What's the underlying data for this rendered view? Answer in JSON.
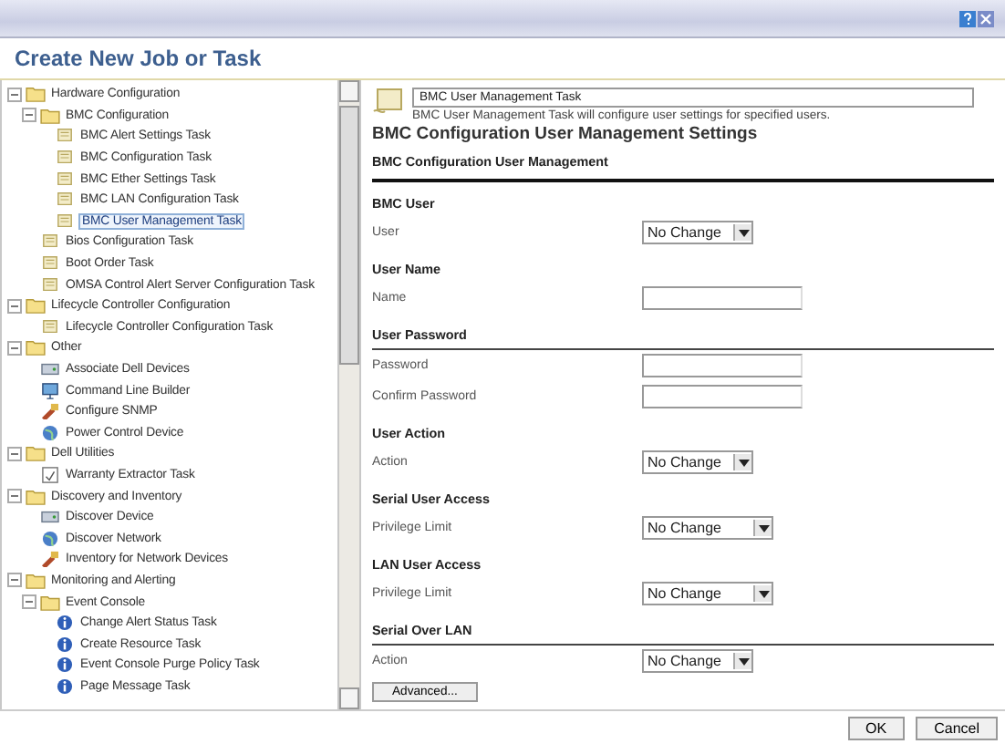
{
  "window": {
    "title": "Create New Job or Task"
  },
  "tree": [
    {
      "label": "Hardware Configuration",
      "kind": "folder",
      "expanded": true,
      "selected": false,
      "children": [
        {
          "label": "BMC Configuration",
          "kind": "folder",
          "expanded": true,
          "selected": false,
          "children": [
            {
              "label": "BMC Alert Settings Task",
              "kind": "task",
              "selected": false
            },
            {
              "label": "BMC Configuration Task",
              "kind": "task",
              "selected": false
            },
            {
              "label": "BMC Ether Settings Task",
              "kind": "task",
              "selected": false
            },
            {
              "label": "BMC LAN Configuration Task",
              "kind": "task",
              "selected": false
            },
            {
              "label": "BMC User Management Task",
              "kind": "task",
              "selected": true
            }
          ]
        },
        {
          "label": "Bios Configuration Task",
          "kind": "task",
          "selected": false
        },
        {
          "label": "Boot Order Task",
          "kind": "task",
          "selected": false
        },
        {
          "label": "OMSA Control Alert Server Configuration Task",
          "kind": "task",
          "selected": false
        }
      ]
    },
    {
      "label": "Lifecycle Controller Configuration",
      "kind": "folder",
      "expanded": true,
      "selected": false,
      "children": [
        {
          "label": "Lifecycle Controller Configuration Task",
          "kind": "task",
          "selected": false
        }
      ]
    },
    {
      "label": "Other",
      "kind": "folder",
      "expanded": true,
      "selected": false,
      "children": [
        {
          "label": "Associate Dell Devices",
          "kind": "device",
          "selected": false
        },
        {
          "label": "Command Line Builder",
          "kind": "computer",
          "selected": false
        },
        {
          "label": "Configure SNMP",
          "kind": "tool",
          "selected": false
        },
        {
          "label": "Power Control Device",
          "kind": "globe",
          "selected": false
        }
      ]
    },
    {
      "label": "Dell Utilities",
      "kind": "folder",
      "expanded": true,
      "selected": false,
      "children": [
        {
          "label": "Warranty Extractor Task",
          "kind": "document",
          "selected": false
        }
      ]
    },
    {
      "label": "Discovery and Inventory",
      "kind": "folder",
      "expanded": true,
      "selected": false,
      "children": [
        {
          "label": "Discover Device",
          "kind": "device",
          "selected": false
        },
        {
          "label": "Discover Network",
          "kind": "globe",
          "selected": false
        },
        {
          "label": "Inventory for Network Devices",
          "kind": "tool",
          "selected": false
        }
      ]
    },
    {
      "label": "Monitoring and Alerting",
      "kind": "folder",
      "expanded": true,
      "selected": false,
      "children": [
        {
          "label": "Event Console",
          "kind": "folder",
          "expanded": true,
          "selected": false,
          "children": [
            {
              "label": "Change Alert Status Task",
              "kind": "info",
              "selected": false
            },
            {
              "label": "Create Resource Task",
              "kind": "info",
              "selected": false
            },
            {
              "label": "Event Console Purge Policy Task",
              "kind": "info",
              "selected": false
            },
            {
              "label": "Page Message Task",
              "kind": "info",
              "selected": false
            }
          ]
        }
      ]
    }
  ],
  "task": {
    "name": "BMC User Management Task",
    "description": "BMC User Management Task will configure user settings for specified users."
  },
  "settings_title": "BMC Configuration User Management Settings",
  "section_title": "BMC Configuration User Management",
  "groups": [
    {
      "heading": "BMC User",
      "divider": false,
      "fields": [
        {
          "label": "User",
          "kind": "select",
          "value": "No Change",
          "wide": false
        }
      ]
    },
    {
      "heading": "User Name",
      "divider": false,
      "fields": [
        {
          "label": "Name",
          "kind": "text"
        }
      ]
    },
    {
      "heading": "User Password",
      "divider": true,
      "fields": [
        {
          "label": "Password",
          "kind": "text"
        },
        {
          "label": "Confirm Password",
          "kind": "text"
        }
      ]
    },
    {
      "heading": "User Action",
      "divider": false,
      "fields": [
        {
          "label": "Action",
          "kind": "select",
          "value": "No Change",
          "wide": false
        }
      ]
    },
    {
      "heading": "Serial User Access",
      "divider": false,
      "fields": [
        {
          "label": "Privilege Limit",
          "kind": "select",
          "value": "No Change",
          "wide": true
        }
      ]
    },
    {
      "heading": "LAN User Access",
      "divider": false,
      "fields": [
        {
          "label": "Privilege Limit",
          "kind": "select",
          "value": "No Change",
          "wide": true
        }
      ]
    },
    {
      "heading": "Serial Over LAN",
      "divider": true,
      "fields": [
        {
          "label": "Action",
          "kind": "select",
          "value": "No Change",
          "wide": false
        }
      ]
    }
  ],
  "advanced_button": "Advanced...",
  "buttons": [
    "OK",
    "Cancel"
  ]
}
